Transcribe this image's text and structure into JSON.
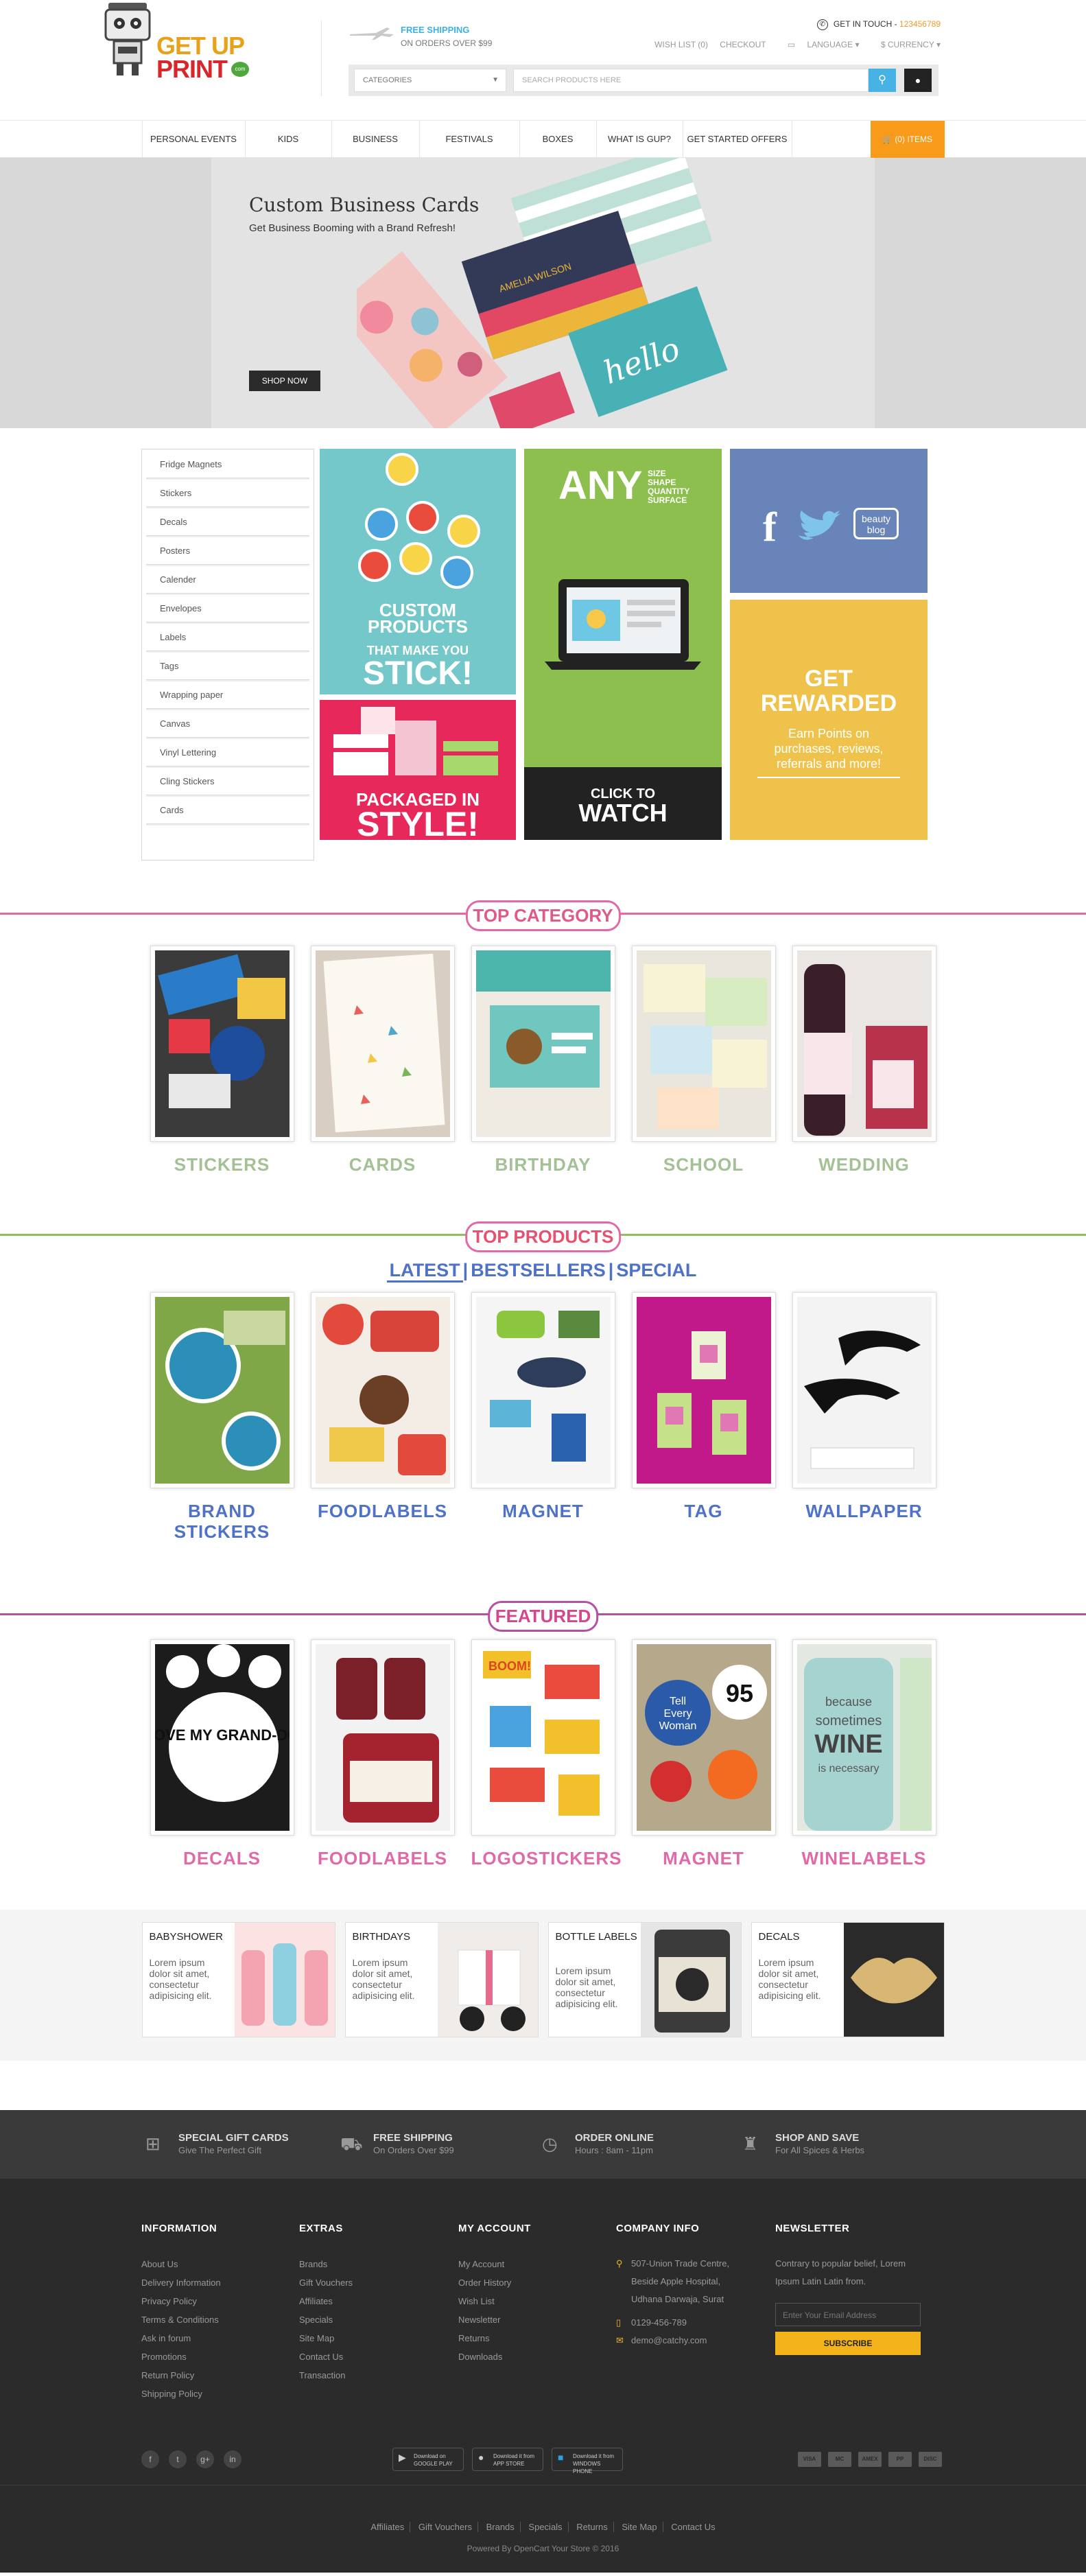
{
  "header": {
    "logo": {
      "line1": "GET UP",
      "line2": "PRINT",
      "badge": "com"
    },
    "shipping": {
      "title": "FREE SHIPPING",
      "subtitle": "ON ORDERS OVER $99"
    },
    "contact": {
      "label": "GET IN TOUCH - ",
      "phone": "123456789"
    },
    "toplinks": [
      "WISH LIST (0)",
      "CHECKOUT",
      "LANGUAGE",
      "$ CURRENCY"
    ],
    "categories_select": "CATEGORIES",
    "search_placeholder": "SEARCH PRODUCTS HERE"
  },
  "nav": {
    "items": [
      "PERSONAL EVENTS",
      "KIDS",
      "BUSINESS",
      "FESTIVALS",
      "BOXES",
      "WHAT IS GUP?",
      "GET STARTED OFFERS"
    ],
    "cart": "(0) ITEMS"
  },
  "hero": {
    "title": "Custom Business Cards",
    "subtitle": "Get Business Booming with a Brand Refresh!",
    "button": "SHOP NOW",
    "card_text": "hello",
    "card_name": "AMELIA WILSON"
  },
  "sidebar": [
    "Fridge Magnets",
    "Stickers",
    "Decals",
    "Posters",
    "Calender",
    "Envelopes",
    "Labels",
    "Tags",
    "Wrapping paper",
    "Canvas",
    "Vinyl Lettering",
    "Cling Stickers",
    "Cards"
  ],
  "banners": {
    "stickers": {
      "l1": "CUSTOM",
      "l2": "PRODUCTS",
      "l3": "THAT MAKE YOU",
      "l4": "STICK!"
    },
    "packaged": {
      "l1": "PACKAGED IN",
      "l2": "STYLE!"
    },
    "any": {
      "big": "ANY",
      "small": [
        "SIZE",
        "SHAPE",
        "QUANTITY",
        "SURFACE"
      ],
      "watch1": "CLICK TO",
      "watch2": "WATCH"
    },
    "social": {
      "fb": "f",
      "blog1": "beauty",
      "blog2": "blog"
    },
    "rewarded": {
      "l1": "GET",
      "l2": "REWARDED",
      "text": "Earn Points on purchases, reviews, referrals and more!"
    }
  },
  "top_category": {
    "title": "TOP CATEGORY",
    "items": [
      "STICKERS",
      "CARDS",
      "BIRTHDAY",
      "SCHOOL",
      "WEDDING"
    ],
    "color": "#a3c195"
  },
  "top_products": {
    "title": "TOP PRODUCTS",
    "tabs": [
      "LATEST",
      "BESTSELLERS",
      "SPECIAL"
    ],
    "items": [
      "BRAND STICKERS",
      "FOODLABELS",
      "MAGNET",
      "TAG",
      "WALLPAPER"
    ],
    "color": "#4e72c7"
  },
  "featured": {
    "title": "FEATURED",
    "items": [
      "DECALS",
      "FOODLABELS",
      "LOGOSTICKERS",
      "MAGNET",
      "WINELABELS"
    ],
    "color": "#e06aa8",
    "texts": {
      "decal": "I LOVE MY GRAND-DOG",
      "boom": "BOOM!",
      "wine1": "because",
      "wine2": "sometimes",
      "wine3": "WINE",
      "wine4": "is necessary",
      "magnet1": "Tell",
      "magnet2": "Every",
      "magnet3": "Woman",
      "magnet4": "95"
    }
  },
  "promos": [
    {
      "title": "BABYSHOWER",
      "text": "Lorem ipsum dolor sit amet, consectetur adipisicing elit."
    },
    {
      "title": "BIRTHDAYS",
      "text": "Lorem ipsum dolor sit amet, consectetur adipisicing elit."
    },
    {
      "title": "BOTTLE LABELS",
      "text": "Lorem ipsum dolor sit amet, consectetur adipisicing elit."
    },
    {
      "title": "DECALS",
      "text": "Lorem ipsum dolor sit amet, consectetur adipisicing elit."
    }
  ],
  "features": [
    {
      "title": "SPECIAL GIFT CARDS",
      "text": "Give The Perfect Gift"
    },
    {
      "title": "FREE SHIPPING",
      "text": "On Orders Over $99"
    },
    {
      "title": "ORDER ONLINE",
      "text": "Hours : 8am - 11pm"
    },
    {
      "title": "SHOP AND SAVE",
      "text": "For All Spices & Herbs"
    }
  ],
  "footer": {
    "information": {
      "title": "INFORMATION",
      "links": [
        "About Us",
        "Delivery Information",
        "Privacy Policy",
        "Terms & Conditions",
        "Ask in forum",
        "Promotions",
        "Return Policy",
        "Shipping Policy"
      ]
    },
    "extras": {
      "title": "EXTRAS",
      "links": [
        "Brands",
        "Gift Vouchers",
        "Affiliates",
        "Specials",
        "Site Map",
        "Contact Us",
        "Transaction"
      ]
    },
    "account": {
      "title": "MY ACCOUNT",
      "links": [
        "My Account",
        "Order History",
        "Wish List",
        "Newsletter",
        "Returns",
        "Downloads"
      ]
    },
    "company": {
      "title": "COMPANY INFO",
      "address": [
        "507-Union Trade Centre,",
        "Beside Apple Hospital,",
        "Udhana Darwaja, Surat"
      ],
      "phone": "0129-456-789",
      "email": "demo@catchy.com"
    },
    "newsletter": {
      "title": "NEWSLETTER",
      "text": "Contrary to popular belief, Lorem Ipsum Latin Latin from.",
      "placeholder": "Enter Your Email Address",
      "button": "SUBSCRIBE"
    },
    "social": [
      "f",
      "t",
      "g+",
      "in"
    ],
    "apps": [
      {
        "l1": "Download on",
        "l2": "GOOGLE PLAY"
      },
      {
        "l1": "Download it from",
        "l2": "APP STORE"
      },
      {
        "l1": "Download it from",
        "l2": "WINDOWS PHONE"
      }
    ],
    "payments": [
      "VISA",
      "MC",
      "AMEX",
      "PP",
      "DISC"
    ],
    "bottom_links": [
      "Affiliates",
      "Gift Vouchers",
      "Brands",
      "Specials",
      "Returns",
      "Site Map",
      "Contact Us"
    ],
    "powered": "Powered By OpenCart Your Store © 2016"
  }
}
